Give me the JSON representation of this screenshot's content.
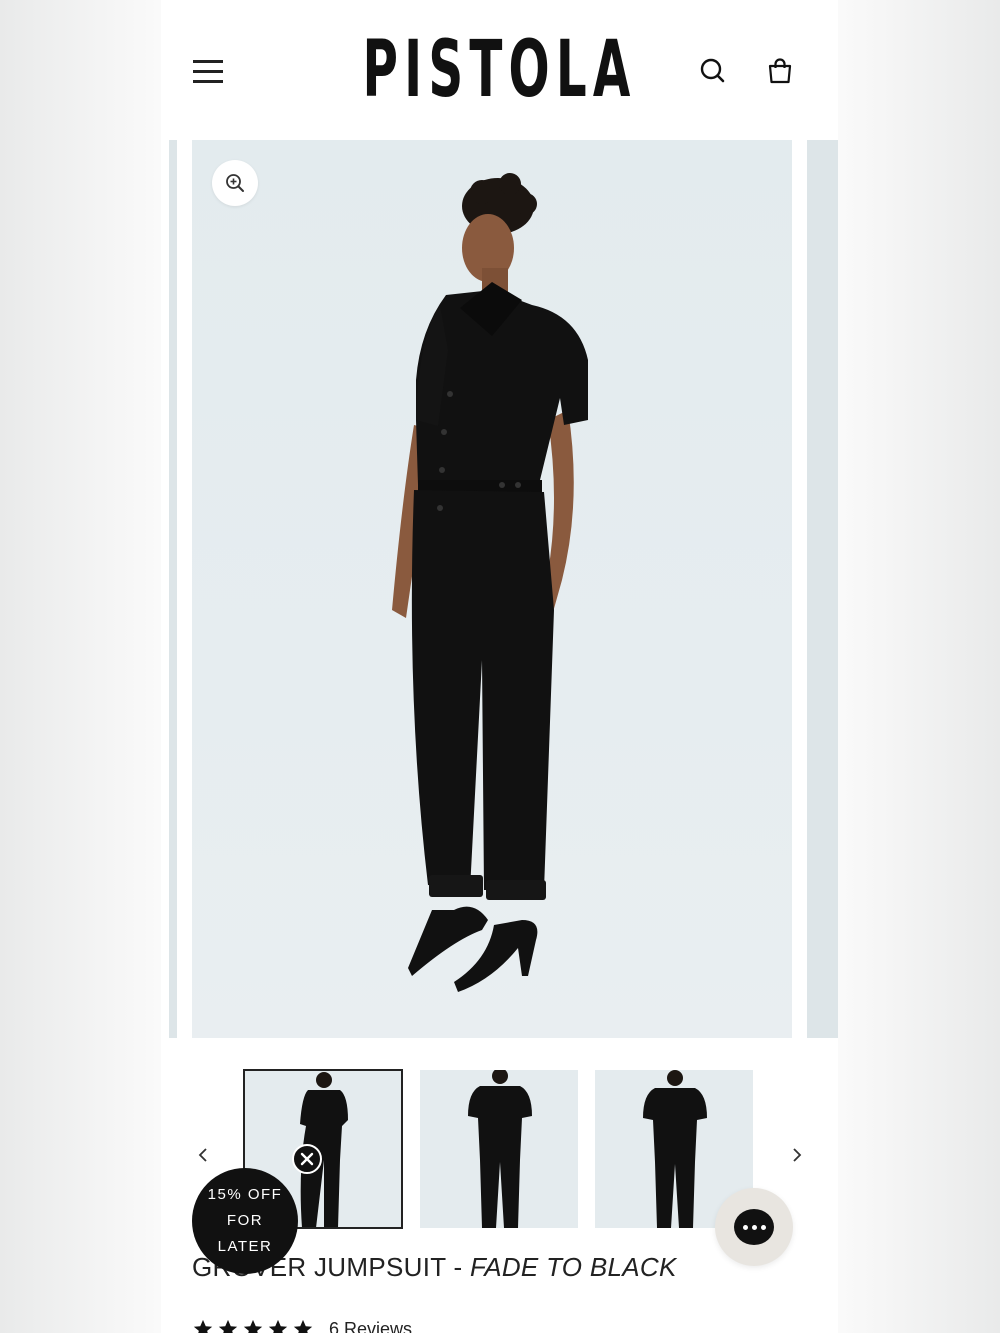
{
  "header": {
    "logo": "PISTOLA",
    "menu_icon": "hamburger-menu-icon",
    "search_icon": "search-icon",
    "cart_icon": "shopping-bag-icon"
  },
  "gallery": {
    "zoom_icon": "zoom-in-icon",
    "image_count": 3,
    "active_index": 0
  },
  "thumbnails": {
    "prev_icon": "chevron-left-icon",
    "next_icon": "chevron-right-icon"
  },
  "product": {
    "name": "GROVER JUMPSUIT",
    "separator": " - ",
    "variant": "FADE TO BLACK",
    "rating_stars": 5,
    "reviews_label": "6 Reviews"
  },
  "promo": {
    "line1": "15% OFF",
    "line2": "FOR",
    "line3": "LATER",
    "close_icon": "close-icon"
  },
  "chat": {
    "icon": "chat-bubble-icon"
  },
  "colors": {
    "text": "#222222",
    "image_bg": "#e4ebee",
    "promo_bg": "#111111",
    "chat_bg": "#e8e5e0"
  }
}
